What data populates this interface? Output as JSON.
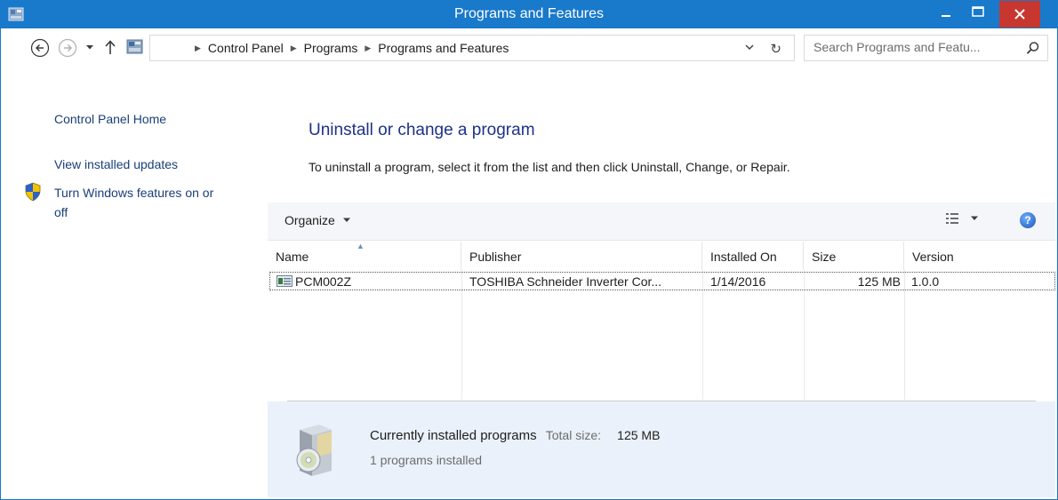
{
  "window": {
    "title": "Programs and Features"
  },
  "colors": {
    "titlebar": "#1979ca",
    "close": "#c7372f",
    "link": "#1a3e7a",
    "heading": "#1e3287",
    "details_bg": "#eaf1fb"
  },
  "nav": {
    "breadcrumbs": [
      "Control Panel",
      "Programs",
      "Programs and Features"
    ],
    "search_placeholder": "Search Programs and Featu..."
  },
  "left_pane": {
    "links": [
      "Control Panel Home",
      "View installed updates",
      "Turn Windows features on or",
      "off"
    ]
  },
  "main": {
    "heading": "Uninstall or change a program",
    "instructions": "To uninstall a program, select it from the list and then click Uninstall, Change, or Repair."
  },
  "toolbar": {
    "organize_label": "Organize",
    "help_label": "?"
  },
  "list": {
    "columns": [
      "Name",
      "Publisher",
      "Installed On",
      "Size",
      "Version"
    ],
    "rows": [
      {
        "name": "PCM002Z",
        "publisher": "TOSHIBA Schneider Inverter Cor...",
        "installed_on": "1/14/2016",
        "size": "125 MB",
        "version": "1.0.0"
      }
    ]
  },
  "details": {
    "title": "Currently installed programs",
    "total_size_label": "Total size:",
    "total_size_value": "125 MB",
    "count_text": "1 programs installed"
  },
  "icons": [
    "control-panel-icon",
    "minimize-icon",
    "maximize-icon",
    "close-icon",
    "back-arrow-icon",
    "forward-arrow-icon",
    "recent-dropdown-icon",
    "up-arrow-icon",
    "refresh-icon",
    "search-icon",
    "uac-shield-icon",
    "view-options-icon",
    "help-icon",
    "program-icon",
    "software-box-icon"
  ]
}
